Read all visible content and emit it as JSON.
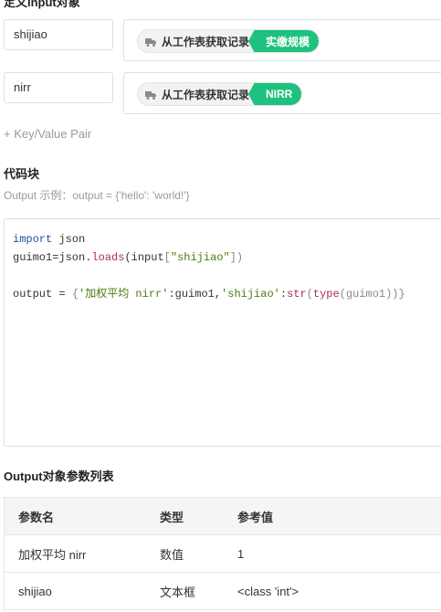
{
  "define_section": {
    "title": "定义Input对象"
  },
  "inputs": [
    {
      "name": "shijiao",
      "chip_label": "从工作表获取记录",
      "tag": "实缴规模"
    },
    {
      "name": "nirr",
      "chip_label": "从工作表获取记录",
      "tag": "NIRR"
    }
  ],
  "add_pair_label": "+ Key/Value Pair",
  "code_section": {
    "title": "代码块",
    "hint": "Output 示例：output = {'hello': 'world!'}"
  },
  "code": {
    "line1_kw": "import",
    "line1_rest": " json",
    "line2_a": "guimo1=json.",
    "line2_fn": "loads",
    "line2_b": "(input",
    "line2_c": "[",
    "line2_str": "\"shijiao\"",
    "line2_d": "])",
    "line3_a": "output = ",
    "line3_b": "{",
    "line3_str1": "'加权平均 nirr'",
    "line3_c": ":guimo1,",
    "line3_str2": "'shijiao'",
    "line3_d": ":",
    "line3_fn1": "str",
    "line3_e": "(",
    "line3_fn2": "type",
    "line3_f": "(guimo1))",
    "line3_g": "}"
  },
  "output_section": {
    "title": "Output对象参数列表"
  },
  "table": {
    "headers": [
      "参数名",
      "类型",
      "参考值"
    ],
    "rows": [
      [
        "加权平均 nirr",
        "数值",
        "1"
      ],
      [
        "shijiao",
        "文本框",
        "<class 'int'>"
      ]
    ]
  },
  "colors": {
    "accent_green": "#1fc17e",
    "keyword_blue": "#1a4fa3",
    "function_red": "#b02a56",
    "string_green": "#4a7b0e"
  },
  "icons": {
    "chip_icon": "truck-icon"
  }
}
